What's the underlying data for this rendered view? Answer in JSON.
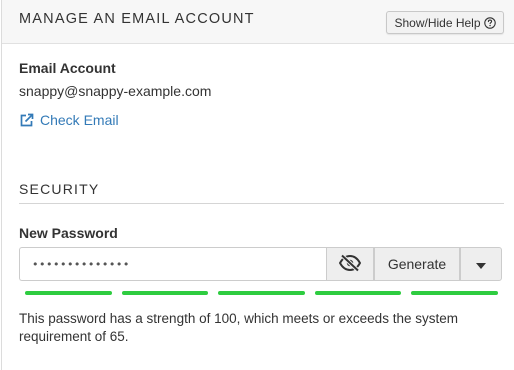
{
  "header": {
    "title": "MANAGE AN EMAIL ACCOUNT",
    "help_button": "Show/Hide Help",
    "help_icon": "question-circle-icon"
  },
  "account": {
    "label": "Email Account",
    "value": "snappy@snappy-example.com",
    "check_email_link": "Check Email",
    "check_email_icon": "external-link-icon"
  },
  "security": {
    "section_title": "SECURITY",
    "password_label": "New Password",
    "password_value": "••••••••••••••",
    "visibility_icon": "eye-slash-icon",
    "generate_label": "Generate",
    "dropdown_icon": "caret-down-icon",
    "strength_score": 100,
    "strength_segments": 5,
    "strength_color": "#2ecc40",
    "strength_message": "This password has a strength of 100, which meets or exceeds the system requirement of 65."
  },
  "colors": {
    "link": "#337ab7",
    "header_bg": "#f7f7f7",
    "button_bg": "#eeeeee"
  }
}
